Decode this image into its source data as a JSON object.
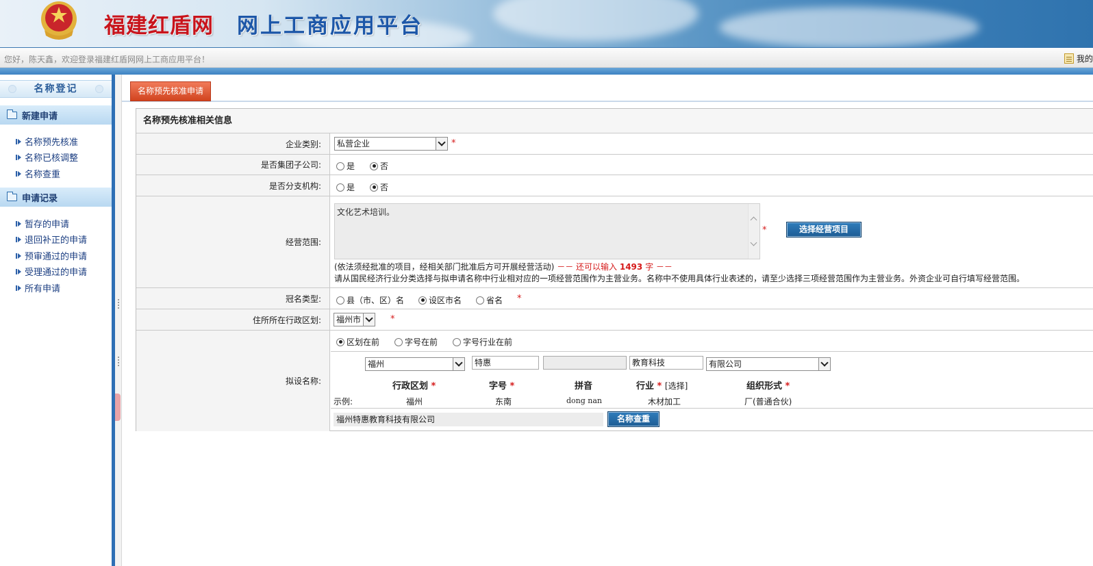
{
  "header": {
    "site_title": "福建红盾网",
    "platform_title": "网上工商应用平台",
    "welcome": "您好，陈天鑫，欢迎登录福建红盾网网上工商应用平台！",
    "mine_label": "我的"
  },
  "sidebar": {
    "title": "名称登记",
    "sections": [
      {
        "label": "新建申请",
        "items": [
          "名称预先核准",
          "名称已核调整",
          "名称查重"
        ]
      },
      {
        "label": "申请记录",
        "items": [
          "暂存的申请",
          "退回补正的申请",
          "预审通过的申请",
          "受理通过的申请",
          "所有申请"
        ]
      }
    ]
  },
  "tab": {
    "label": "名称预先核准申请"
  },
  "form": {
    "title": "名称预先核准相关信息",
    "enterprise_type": {
      "label": "企业类别:",
      "value": "私营企业"
    },
    "group_sub": {
      "label": "是否集团子公司:",
      "options": [
        "是",
        "否"
      ],
      "selected": "否"
    },
    "branch": {
      "label": "是否分支机构:",
      "options": [
        "是",
        "否"
      ],
      "selected": "否"
    },
    "scope": {
      "label": "经营范围:",
      "value": "文化艺术培训。",
      "select_button": "选择经营项目",
      "note_prefix": "(依法须经批准的项目，经相关部门批准后方可开展经营活动)",
      "remaining_prefix": "－－  还可以输入",
      "remaining_count": "1493",
      "remaining_suffix": "字 －－",
      "hint": "请从国民经济行业分类选择与拟申请名称中行业相对应的一项经营范围作为主营业务。名称中不使用具体行业表述的，请至少选择三项经营范围作为主营业务。外资企业可自行填写经营范围。"
    },
    "crown_type": {
      "label": "冠名类型:",
      "options": [
        "县（市、区）名",
        "设区市名",
        "省名"
      ],
      "selected": "设区市名"
    },
    "district": {
      "label": "住所所在行政区划:",
      "value": "福州市"
    },
    "proposed_name": {
      "label": "拟设名称:",
      "order_options": [
        "区划在前",
        "字号在前",
        "字号行业在前"
      ],
      "order_selected": "区划在前",
      "region": "福州",
      "brand": "特惠",
      "pinyin": "",
      "industry": "教育科技",
      "org_form": "有限公司",
      "headers": {
        "region": "行政区划",
        "brand": "字号",
        "pinyin": "拼音",
        "industry": "行业",
        "industry_select": "[选择]",
        "org_form": "组织形式"
      },
      "example_label": "示例:",
      "example": {
        "region": "福州",
        "brand": "东南",
        "pinyin": "dong nan",
        "industry": "木材加工",
        "org_form": "厂(普通合伙)"
      },
      "full_name": "福州特惠教育科技有限公司",
      "check_button": "名称查重"
    },
    "required_mark": "*"
  }
}
